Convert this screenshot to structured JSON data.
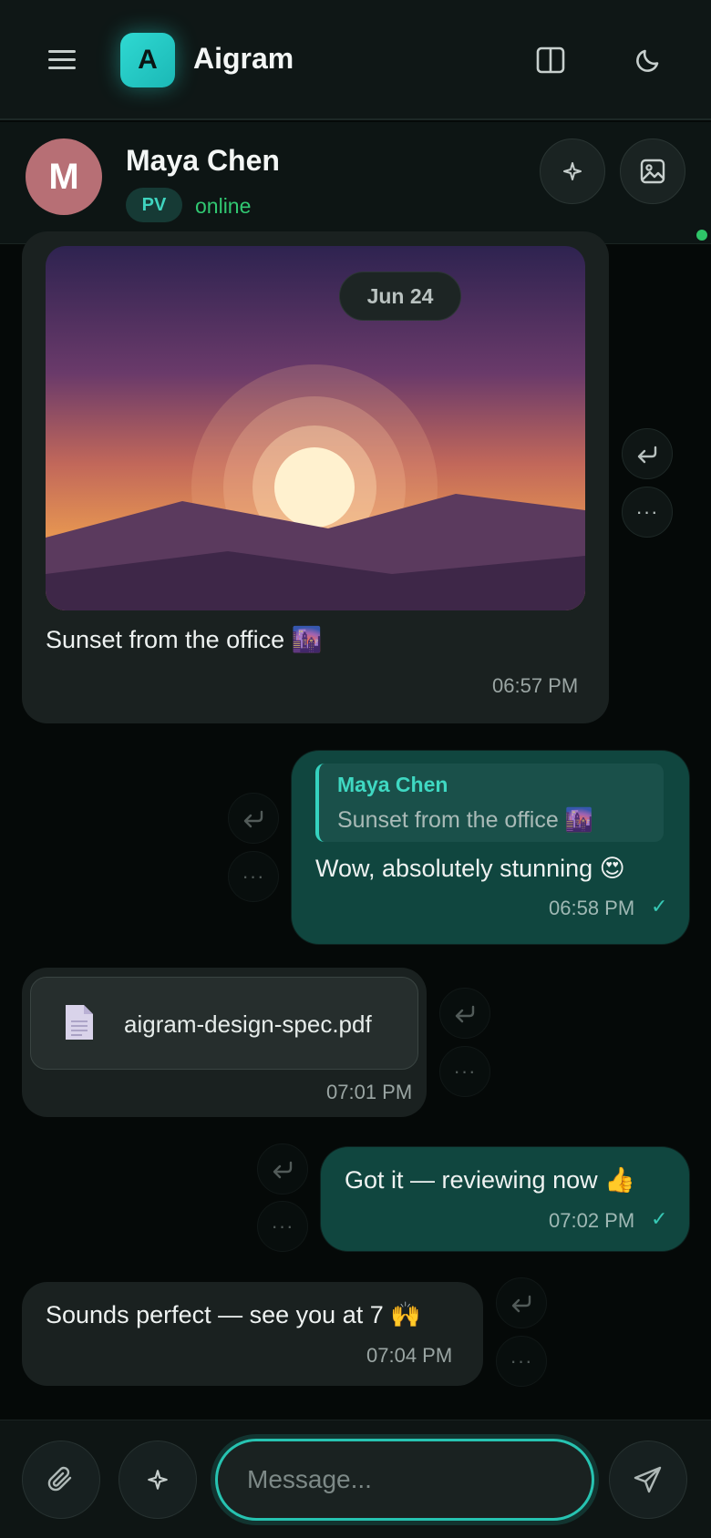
{
  "app": {
    "logo_letter": "A",
    "title": "Aigram"
  },
  "contact": {
    "initial": "M",
    "name": "Maya Chen",
    "badge": "PV",
    "status": "online"
  },
  "date_divider": "Jun 24",
  "messages": [
    {
      "direction": "in",
      "type": "photo",
      "caption": "Sunset from the office 🌆",
      "time": "06:57 PM"
    },
    {
      "direction": "out",
      "type": "reply",
      "quote_author": "Maya Chen",
      "quote_text": "Sunset from the office 🌆",
      "text": "Wow, absolutely stunning 😍",
      "time": "06:58 PM",
      "status_icon": "✓"
    },
    {
      "direction": "in",
      "type": "file",
      "file_name": "aigram-design-spec.pdf",
      "time": "07:01 PM"
    },
    {
      "direction": "out",
      "type": "text",
      "text": "Got it — reviewing now 👍",
      "time": "07:02 PM",
      "status_icon": "✓"
    },
    {
      "direction": "in",
      "type": "text",
      "text": "Sounds perfect — see you at 7 🙌",
      "time": "07:04 PM"
    }
  ],
  "composer": {
    "placeholder": "Message..."
  },
  "icons": {
    "menu": "hamburger-icon",
    "layout": "split-panel-icon",
    "theme": "moon-icon",
    "ai": "sparkle-icon",
    "gallery": "image-icon",
    "reply": "reply-arrow-icon",
    "more": "ellipsis-icon",
    "file": "document-icon",
    "attach": "paperclip-icon",
    "send": "send-icon"
  },
  "colors": {
    "accent": "#2fd9d2",
    "online": "#31c872",
    "outgoing_bubble": "#10463f",
    "incoming_bubble": "#1a2120"
  }
}
